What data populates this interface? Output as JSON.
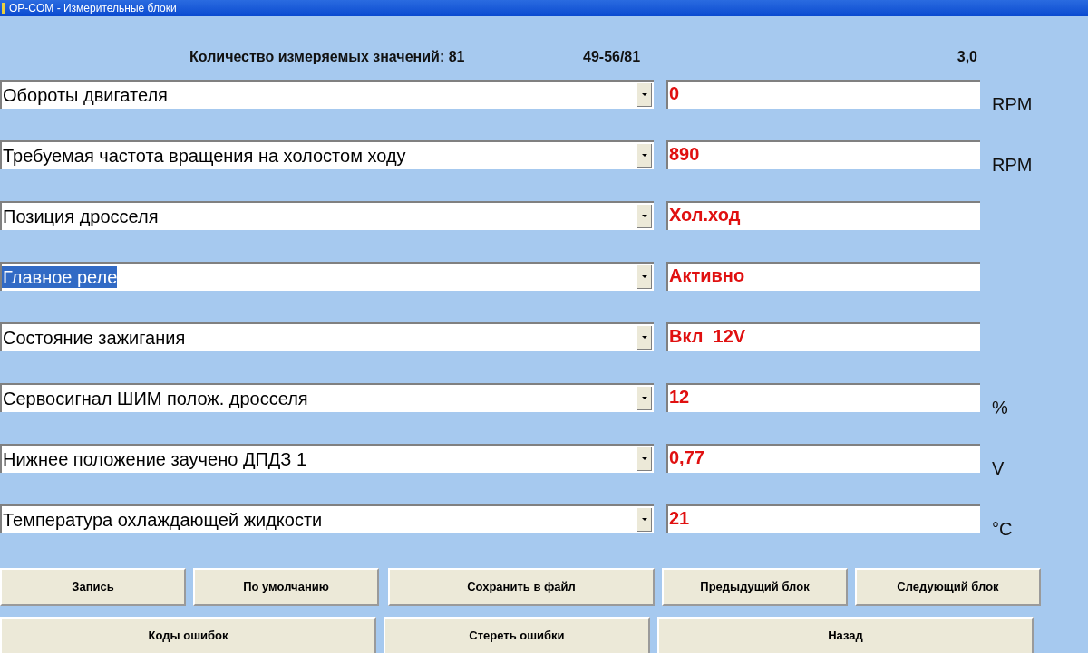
{
  "window": {
    "title": "OP-COM - Измерительные блоки"
  },
  "header": {
    "count": "Количество измеряемых значений: 81",
    "range": "49-56/81",
    "version": "3,0"
  },
  "rows": [
    {
      "label": "Обороты двигателя",
      "selected": false,
      "value": "0",
      "unit": "RPM"
    },
    {
      "label": "Требуемая частота вращения на холостом ходу",
      "selected": false,
      "value": "890",
      "unit": "RPM"
    },
    {
      "label": "Позиция дросселя",
      "selected": false,
      "value": "Хол.ход"
    },
    {
      "label": "Главное реле",
      "selected": true,
      "value": "Активно"
    },
    {
      "label": "Состояние зажигания",
      "selected": false,
      "value": "Вкл  12V"
    },
    {
      "label": "Сервосигнал ШИМ полож. дросселя",
      "selected": false,
      "value": "12",
      "unit": "%"
    },
    {
      "label": "Нижнее положение заучено ДПДЗ 1",
      "selected": false,
      "value": "0,77",
      "unit": "V"
    },
    {
      "label": "Температура охлаждающей жидкости",
      "selected": false,
      "value": "21",
      "unit": "°C"
    }
  ],
  "buttons_top": [
    "Запись",
    "По умолчанию",
    "Сохранить в файл",
    "Предыдущий блок",
    "Следующий блок"
  ],
  "buttons_bottom": [
    "Коды ошибок",
    "Стереть ошибки",
    "Назад"
  ]
}
